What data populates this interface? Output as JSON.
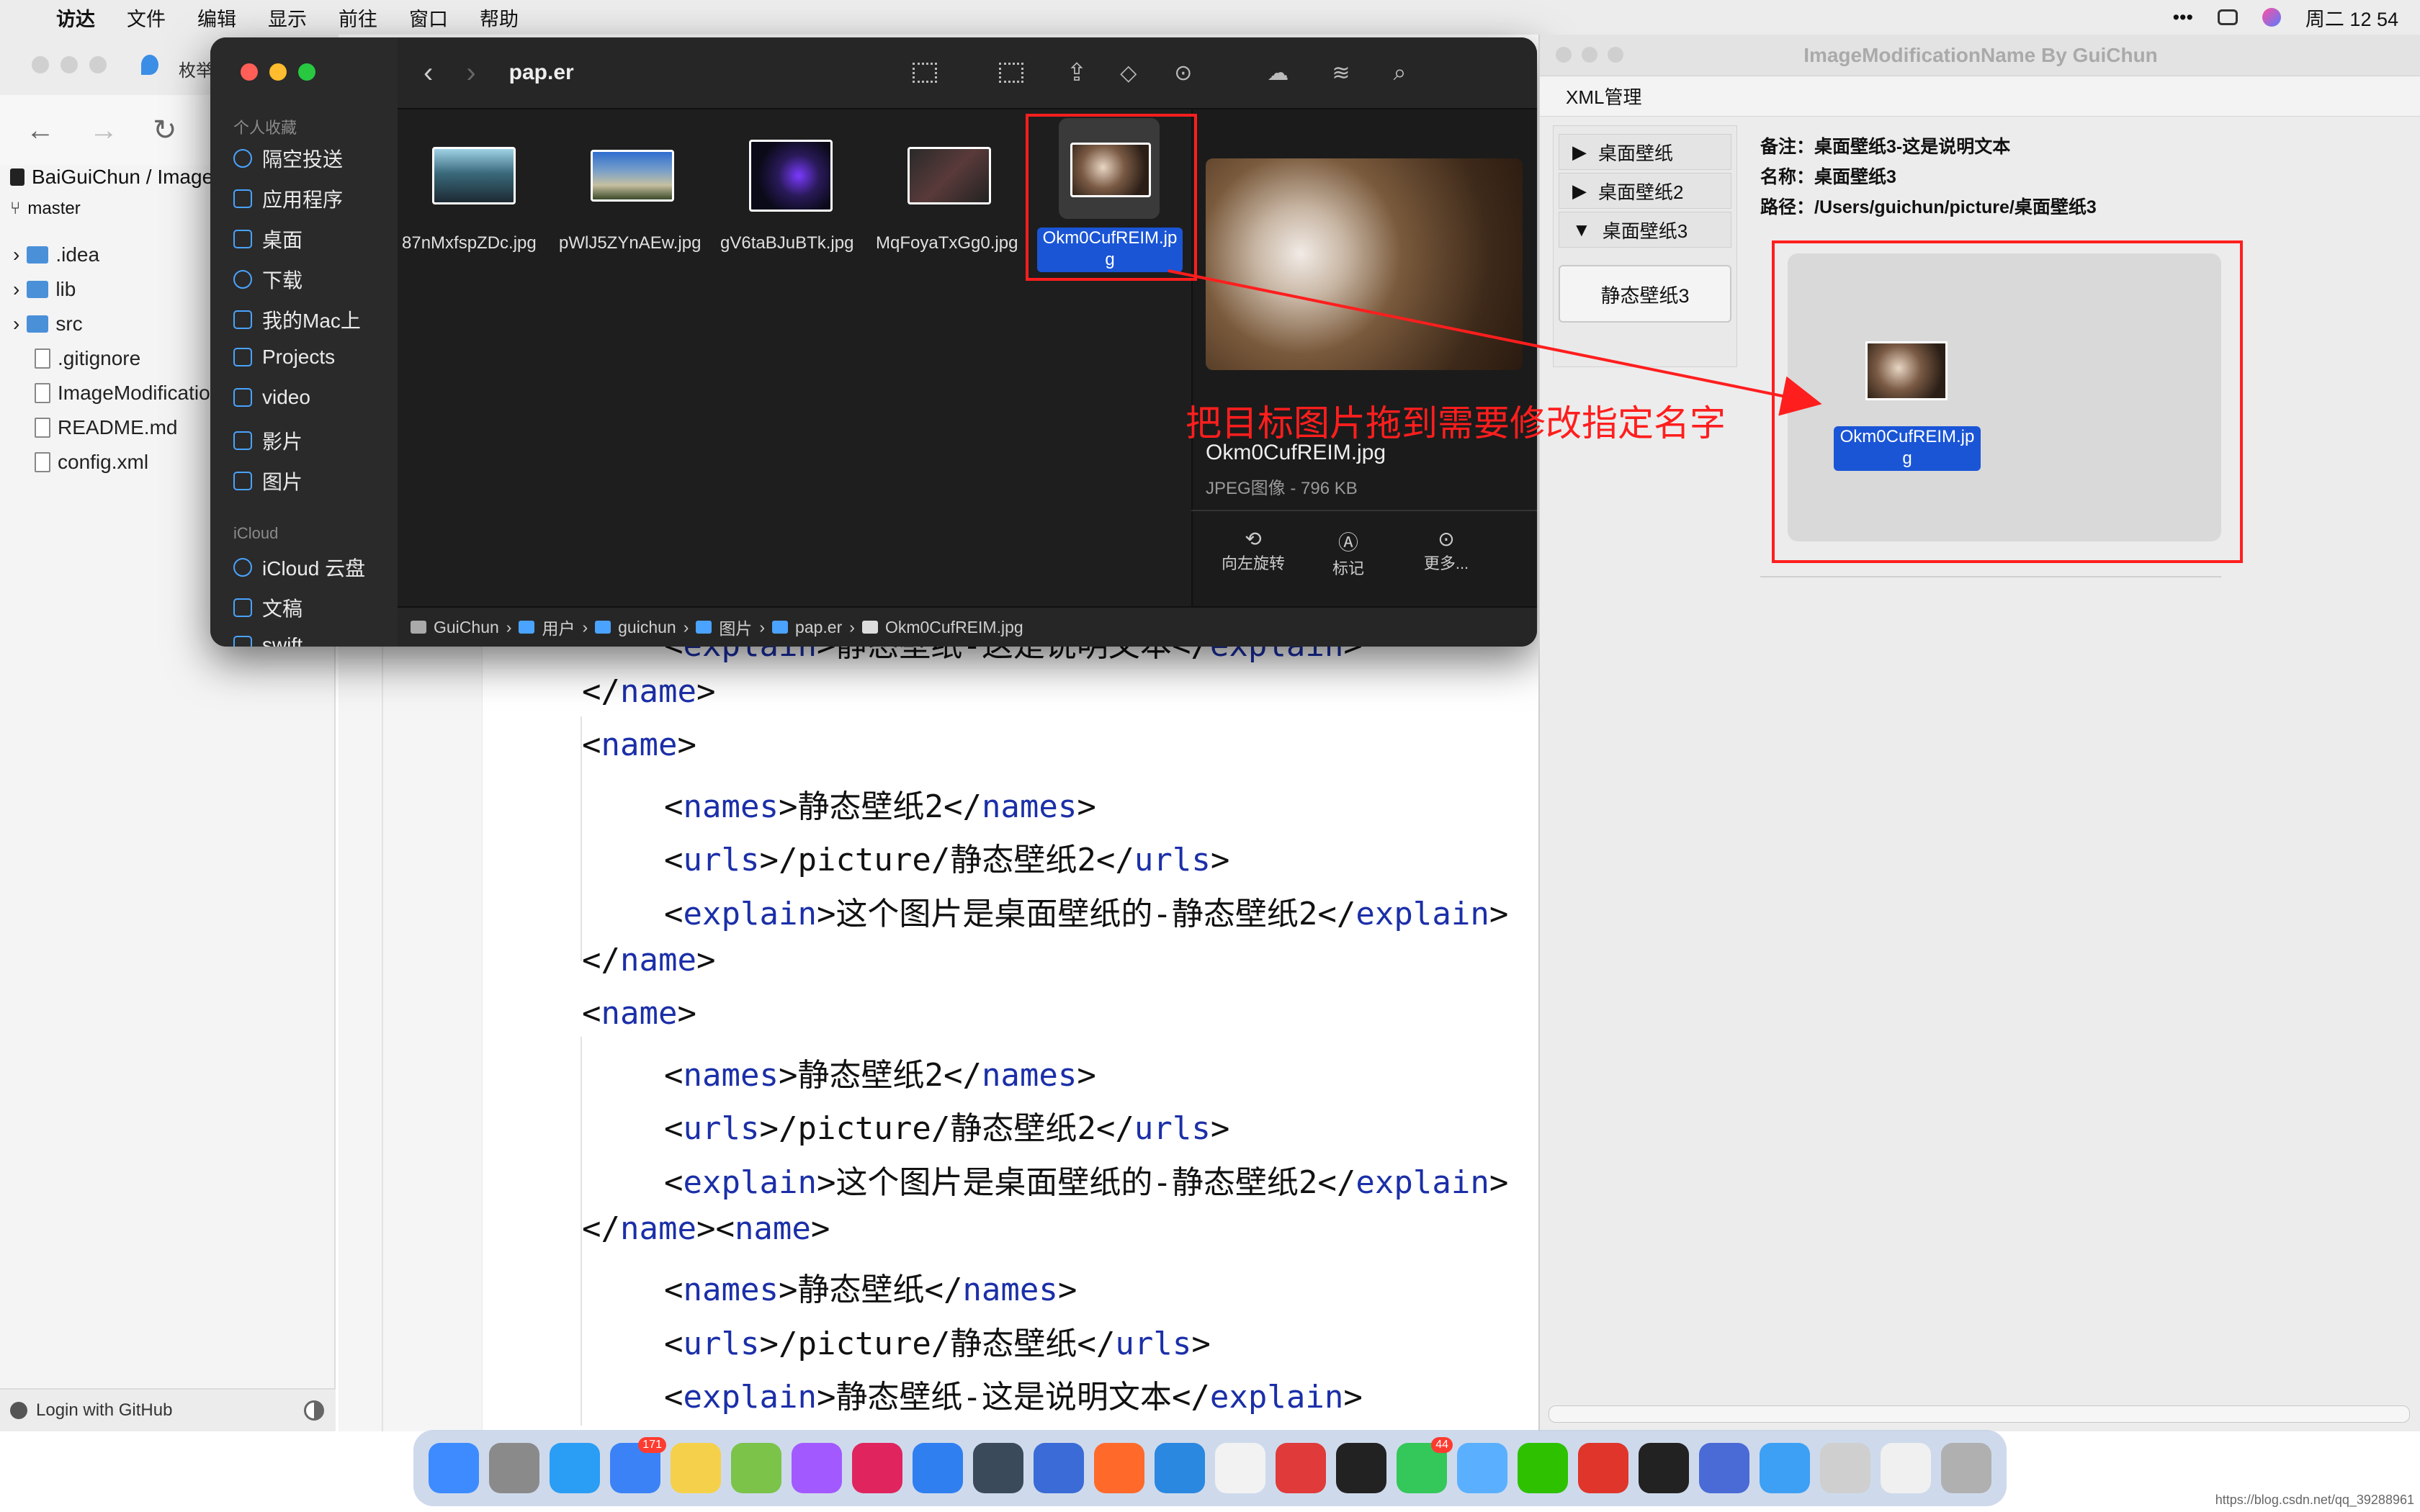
{
  "menubar": {
    "items": [
      "访达",
      "文件",
      "编辑",
      "显示",
      "前往",
      "窗口",
      "帮助"
    ],
    "clock": "周二 12 54",
    "more": "•••"
  },
  "ide": {
    "tab_partial": "枚举",
    "project_path": "BaiGuiChun / Image",
    "branch": "master",
    "tree": [
      ".idea",
      "lib",
      "src",
      ".gitignore",
      "ImageModificatio",
      "README.md",
      "config.xml"
    ],
    "login": "Login with GitHub"
  },
  "editor": {
    "lines": [
      {
        "indent": 1,
        "open": "explain",
        "text": "静态壁纸-这是说明文本",
        "close": "explain"
      },
      {
        "indent": 0,
        "close_only": "name"
      },
      {
        "indent": 0,
        "open_only": "name"
      },
      {
        "indent": 1,
        "open": "names",
        "text": "静态壁纸2",
        "close": "names"
      },
      {
        "indent": 1,
        "open": "urls",
        "text": "/picture/静态壁纸2",
        "close": "urls"
      },
      {
        "indent": 1,
        "open": "explain",
        "text": "这个图片是桌面壁纸的-静态壁纸2",
        "close": "explain"
      },
      {
        "indent": 0,
        "close_only": "name"
      },
      {
        "indent": 0,
        "open_only": "name"
      },
      {
        "indent": 1,
        "open": "names",
        "text": "静态壁纸2",
        "close": "names"
      },
      {
        "indent": 1,
        "open": "urls",
        "text": "/picture/静态壁纸2",
        "close": "urls"
      },
      {
        "indent": 1,
        "open": "explain",
        "text": "这个图片是桌面壁纸的-静态壁纸2",
        "close": "explain"
      },
      {
        "indent": 0,
        "close_open": "name"
      },
      {
        "indent": 1,
        "open": "names",
        "text": "静态壁纸",
        "close": "names"
      },
      {
        "indent": 1,
        "open": "urls",
        "text": "/picture/静态壁纸",
        "close": "urls"
      },
      {
        "indent": 1,
        "open": "explain",
        "text": "静态壁纸-这是说明文本",
        "close": "explain"
      }
    ]
  },
  "finder": {
    "title": "pap.er",
    "sidebar": {
      "favorites_header": "个人收藏",
      "favorites": [
        "隔空投送",
        "应用程序",
        "桌面",
        "下载",
        "我的Mac上",
        "Projects",
        "video",
        "影片",
        "图片"
      ],
      "icloud_header": "iCloud",
      "icloud": [
        "iCloud 云盘",
        "文稿",
        "swift"
      ]
    },
    "files": [
      "87nMxfspZDc.jpg",
      "pWlJ5ZYnAEw.jpg",
      "gV6taBJuBTk.jpg",
      "MqFoyaTxGg0.jpg",
      "Okm0CufREIM.jpg"
    ],
    "selected_label_line1": "Okm0CufREIM.jp",
    "selected_label_line2": "g",
    "preview": {
      "name": "Okm0CufREIM.jpg",
      "meta": "JPEG图像 - 796 KB",
      "actions": [
        "向左旋转",
        "标记",
        "更多..."
      ]
    },
    "pathbar": [
      "GuiChun",
      "用户",
      "guichun",
      "图片",
      "pap.er",
      "Okm0CufREIM.jpg"
    ]
  },
  "app": {
    "title": "ImageModificationName By GuiChun",
    "menu": "XML管理",
    "tree": [
      {
        "label": "桌面壁纸",
        "expanded": false
      },
      {
        "label": "桌面壁纸2",
        "expanded": false
      },
      {
        "label": "桌面壁纸3",
        "expanded": true
      }
    ],
    "child_button": "静态壁纸3",
    "info": {
      "remark": "备注：桌面壁纸3-这是说明文本",
      "name": "名称：桌面壁纸3",
      "path": "路径：/Users/guichun/picture/桌面壁纸3"
    },
    "drop_label_line1": "Okm0CufREIM.jp",
    "drop_label_line2": "g"
  },
  "annotation": {
    "text": "把目标图片拖到需要修改指定名字",
    "color": "#ff1e1e"
  },
  "dock": {
    "icons": [
      "finder-icon",
      "launchpad-icon",
      "safari-icon",
      "mail-icon",
      "notes-icon",
      "chameleon-icon",
      "figma-icon",
      "intellij-icon",
      "xcode-icon",
      "instruments-icon",
      "sourcetree-icon",
      "office-icon",
      "edge-icon",
      "typora-icon",
      "pdf-icon",
      "qq-icon",
      "messages-icon",
      "preview-icon",
      "wechat-icon",
      "wps-icon",
      "terminal-icon",
      "keynote-icon",
      "folder-icon",
      "printer-icon",
      "document-icon",
      "trash-icon"
    ],
    "badges": {
      "mail-icon": "171",
      "messages-icon": "44"
    }
  },
  "watermark": "https://blog.csdn.net/qq_39288961"
}
